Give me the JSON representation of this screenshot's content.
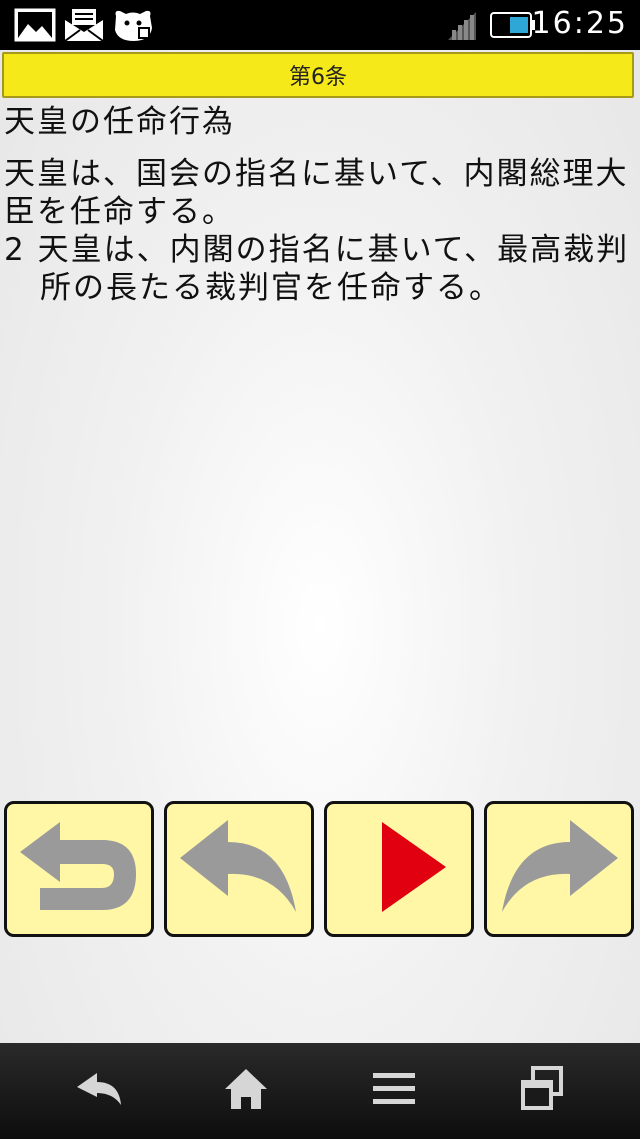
{
  "status_bar": {
    "time": "16:25",
    "icons": [
      "image-notification-icon",
      "mail-notification-icon",
      "app-notification-icon",
      "signal-icon",
      "battery-icon"
    ]
  },
  "article": {
    "title": "第6条",
    "heading": "天皇の任命行為",
    "paragraph1": "天皇は、国会の指名に基いて、内閣総理大臣を任命する。",
    "paragraph2": "2 天皇は、内閣の指名に基いて、最高裁判所の長たる裁判官を任命する。"
  },
  "controls": {
    "buttons": [
      "return-icon",
      "previous-icon",
      "play-icon",
      "next-icon"
    ],
    "colors": {
      "button_bg": "#fff7a6",
      "arrow": "#9a9a9a",
      "play": "#e0000f"
    }
  },
  "navigation": {
    "buttons": [
      "back-icon",
      "home-icon",
      "menu-icon",
      "recent-apps-icon"
    ]
  },
  "colors": {
    "title_bar": "#f6e91a",
    "status_bar": "#000000"
  }
}
